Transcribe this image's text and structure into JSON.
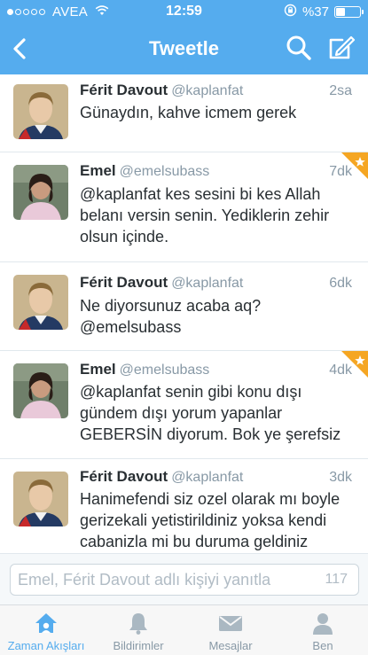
{
  "status_bar": {
    "carrier": "AVEA",
    "time": "12:59",
    "battery": "%37",
    "battery_level": 0.37
  },
  "nav": {
    "back_icon": "chevron-left-icon",
    "title": "Tweetle",
    "search_icon": "search-icon",
    "compose_icon": "compose-icon"
  },
  "tweets": [
    {
      "name": "Férit Davout",
      "handle": "@kaplanfat",
      "time": "2sa",
      "text": "Günaydın, kahve icmem gerek",
      "avatar": "portrait-avatar",
      "favorited": false
    },
    {
      "name": "Emel",
      "handle": "@emelsubass",
      "time": "7dk",
      "text": "@kaplanfat kes sesini bi kes Allah belanı versin senin. Yediklerin zehir olsun içinde.",
      "avatar": "woman-avatar",
      "favorited": true
    },
    {
      "name": "Férit Davout",
      "handle": "@kaplanfat",
      "time": "6dk",
      "text": "Ne diyorsunuz acaba aq? @emelsubass",
      "avatar": "portrait-avatar",
      "favorited": false
    },
    {
      "name": "Emel",
      "handle": "@emelsubass",
      "time": "4dk",
      "text": "@kaplanfat senin gibi konu dışı gündem dışı yorum yapanlar GEBERSİN diyorum. Bok ye şerefsiz",
      "avatar": "woman-avatar",
      "favorited": true
    },
    {
      "name": "Férit Davout",
      "handle": "@kaplanfat",
      "time": "3dk",
      "text": "Hanimefendi siz ozel olarak mı boyle gerizekali yetistirildiniz yoksa kendi cabanizla mi bu duruma geldiniz",
      "avatar": "portrait-avatar",
      "favorited": false
    }
  ],
  "reply": {
    "placeholder": "Emel, Férit Davout adlı kişiyi yanıtla",
    "char_count": "117"
  },
  "tabs": [
    {
      "label": "Zaman Akışları",
      "icon": "home-icon",
      "active": true
    },
    {
      "label": "Bildirimler",
      "icon": "bell-icon",
      "active": false
    },
    {
      "label": "Mesajlar",
      "icon": "envelope-icon",
      "active": false
    },
    {
      "label": "Ben",
      "icon": "person-icon",
      "active": false
    }
  ],
  "colors": {
    "brand_blue": "#55acee",
    "star_orange": "#f5a623",
    "muted_gray": "#8899a6"
  }
}
